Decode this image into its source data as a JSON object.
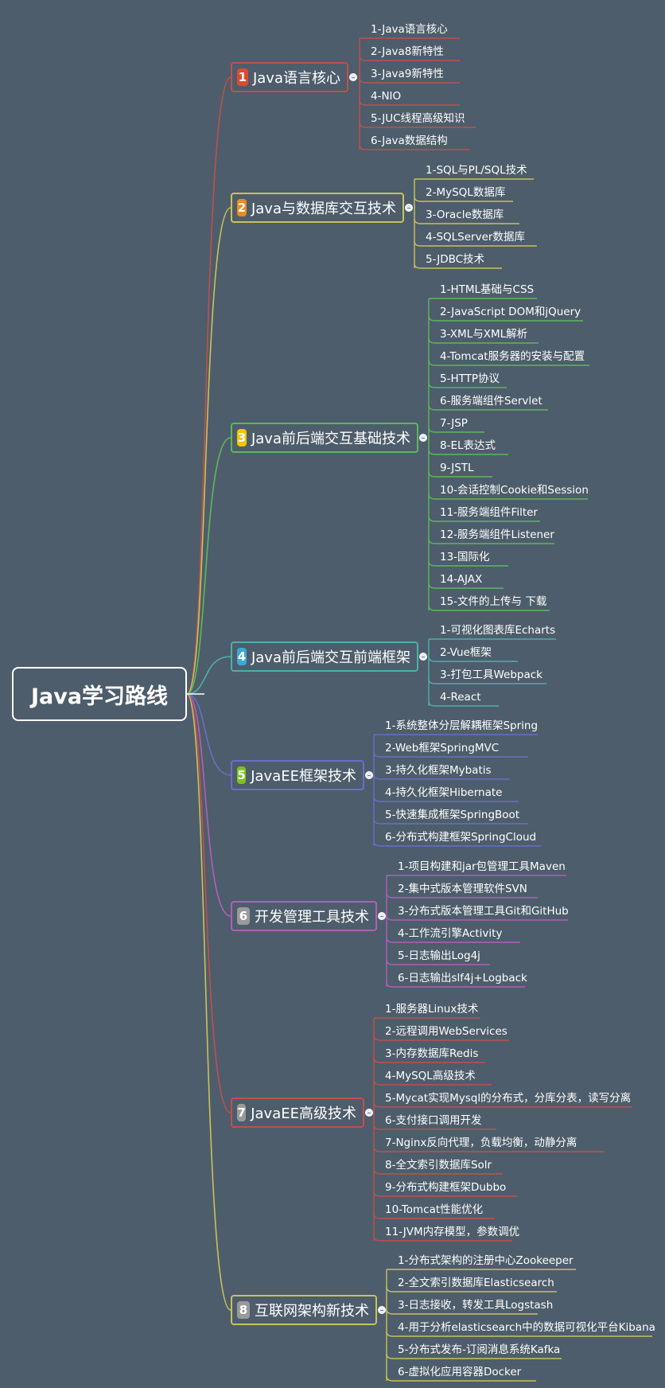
{
  "root": {
    "label": "Java学习路线"
  },
  "branches": [
    {
      "num": "1",
      "label": "Java语言核心",
      "color": "#c0504d",
      "badge_color": "#e04a2f",
      "items": [
        "1-Java语言核心",
        "2-Java8新特性",
        "3-Java9新特性",
        "4-NIO",
        "5-JUC线程高级知识",
        "6-Java数据结构"
      ]
    },
    {
      "num": "2",
      "label": "Java与数据库交互技术",
      "color": "#c9c25a",
      "badge_color": "#f08a1c",
      "items": [
        "1-SQL与PL/SQL技术",
        "2-MySQL数据库",
        "3-Oracle数据库",
        "4-SQLServer数据库",
        "5-JDBC技术"
      ]
    },
    {
      "num": "3",
      "label": "Java前后端交互基础技术",
      "color": "#5cb85c",
      "badge_color": "#f5c400",
      "items": [
        "1-HTML基础与CSS",
        "2-JavaScript DOM和jQuery",
        "3-XML与XML解析",
        "4-Tomcat服务器的安装与配置",
        "5-HTTP协议",
        "6-服务端组件Servlet",
        "7-JSP",
        "8-EL表达式",
        "9-JSTL",
        "10-会话控制Cookie和Session",
        "11-服务端组件Filter",
        "12-服务端组件Listener",
        "13-国际化",
        "14-AJAX",
        "15-文件的上传与 下载"
      ]
    },
    {
      "num": "4",
      "label": "Java前后端交互前端框架",
      "color": "#4fb0a8",
      "badge_color": "#3aa8d8",
      "items": [
        "1-可视化图表库Echarts",
        "2-Vue框架",
        "3-打包工具Webpack",
        "4-React"
      ]
    },
    {
      "num": "5",
      "label": "JavaEE框架技术",
      "color": "#6a6ec8",
      "badge_color": "#7cc41c",
      "items": [
        "1-系统整体分层解耦框架Spring",
        "2-Web框架SpringMVC",
        "3-持久化框架Mybatis",
        "4-持久化框架Hibernate",
        "5-快速集成框架SpringBoot",
        "6-分布式构建框架SpringCloud"
      ]
    },
    {
      "num": "6",
      "label": "开发管理工具技术",
      "color": "#b060b8",
      "badge_color": "#9a9a9a",
      "items": [
        "1-项目构建和jar包管理工具Maven",
        "2-集中式版本管理软件SVN",
        "3-分布式版本管理工具Git和GitHub",
        "4-工作流引擎Activity",
        "5-日志输出Log4j",
        "6-日志输出slf4j+Logback"
      ]
    },
    {
      "num": "7",
      "label": "JavaEE高级技术",
      "color": "#c0504d",
      "badge_color": "#9a9a9a",
      "items": [
        "1-服务器Linux技术",
        "2-远程调用WebServices",
        "3-内存数据库Redis",
        "4-MySQL高级技术",
        "5-Mycat实现Mysql的分布式，分库分表，读写分离",
        "6-支付接口调用开发",
        "7-Nginx反向代理，负载均衡，动静分离",
        "8-全文索引数据库Solr",
        "9-分布式构建框架Dubbo",
        "10-Tomcat性能优化",
        "11-JVM内存模型，参数调优"
      ]
    },
    {
      "num": "8",
      "label": "互联网架构新技术",
      "color": "#c9c25a",
      "badge_color": "#9a9a9a",
      "items": [
        "1-分布式架构的注册中心Zookeeper",
        "2-全文索引数据库Elasticsearch",
        "3-日志接收，转发工具Logstash",
        "4-用于分析elasticsearch中的数据可视化平台Kibana",
        "5-分布式发布-订阅消息系统Kafka",
        "6-虚拟化应用容器Docker"
      ]
    }
  ]
}
